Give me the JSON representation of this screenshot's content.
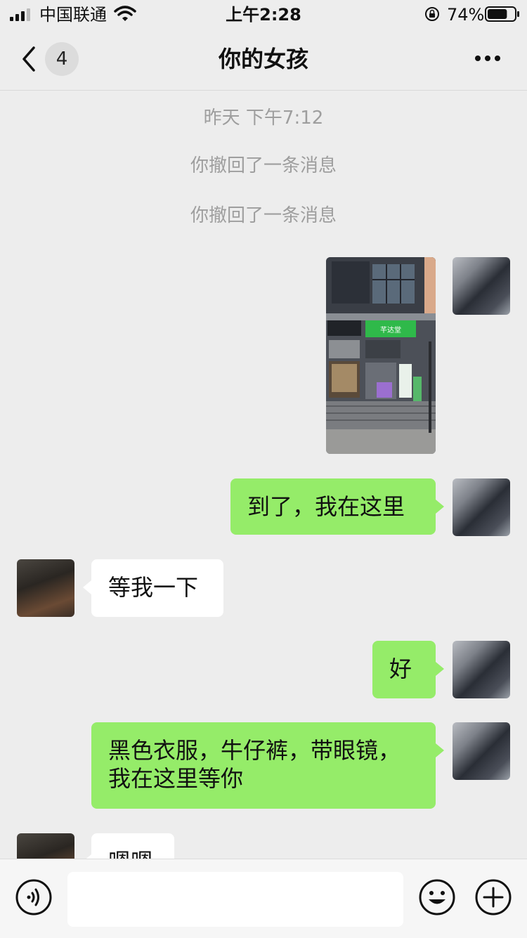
{
  "status_bar": {
    "carrier": "中国联通",
    "time": "上午2:28",
    "battery_percent": "74%",
    "signal_icon": "signal-bars-icon",
    "wifi_icon": "wifi-icon",
    "lock_icon": "rotation-lock-icon",
    "battery_icon": "battery-icon",
    "battery_level": 0.74
  },
  "nav": {
    "back_icon": "chevron-left-icon",
    "unread_count": "4",
    "title": "你的女孩",
    "more_icon": "more-dots-icon"
  },
  "messages": {
    "timestamp": "昨天 下午7:12",
    "recall_1": "你撤回了一条消息",
    "recall_2": "你撤回了一条消息",
    "photo_sign": "芊达堂",
    "msg_1": "到了，我在这里",
    "msg_2": "等我一下",
    "msg_3": "好",
    "msg_4_line1": "黑色衣服，牛仔裤，带眼镜，",
    "msg_4_line2": "我在这里等你",
    "msg_5": "嗯嗯"
  },
  "input_bar": {
    "voice_icon": "voice-icon",
    "input_value": "",
    "emoji_icon": "emoji-icon",
    "plus_icon": "plus-circle-icon"
  },
  "colors": {
    "background": "#ededed",
    "my_bubble": "#95ec69",
    "their_bubble": "#ffffff",
    "system_text": "#9e9e9e"
  }
}
